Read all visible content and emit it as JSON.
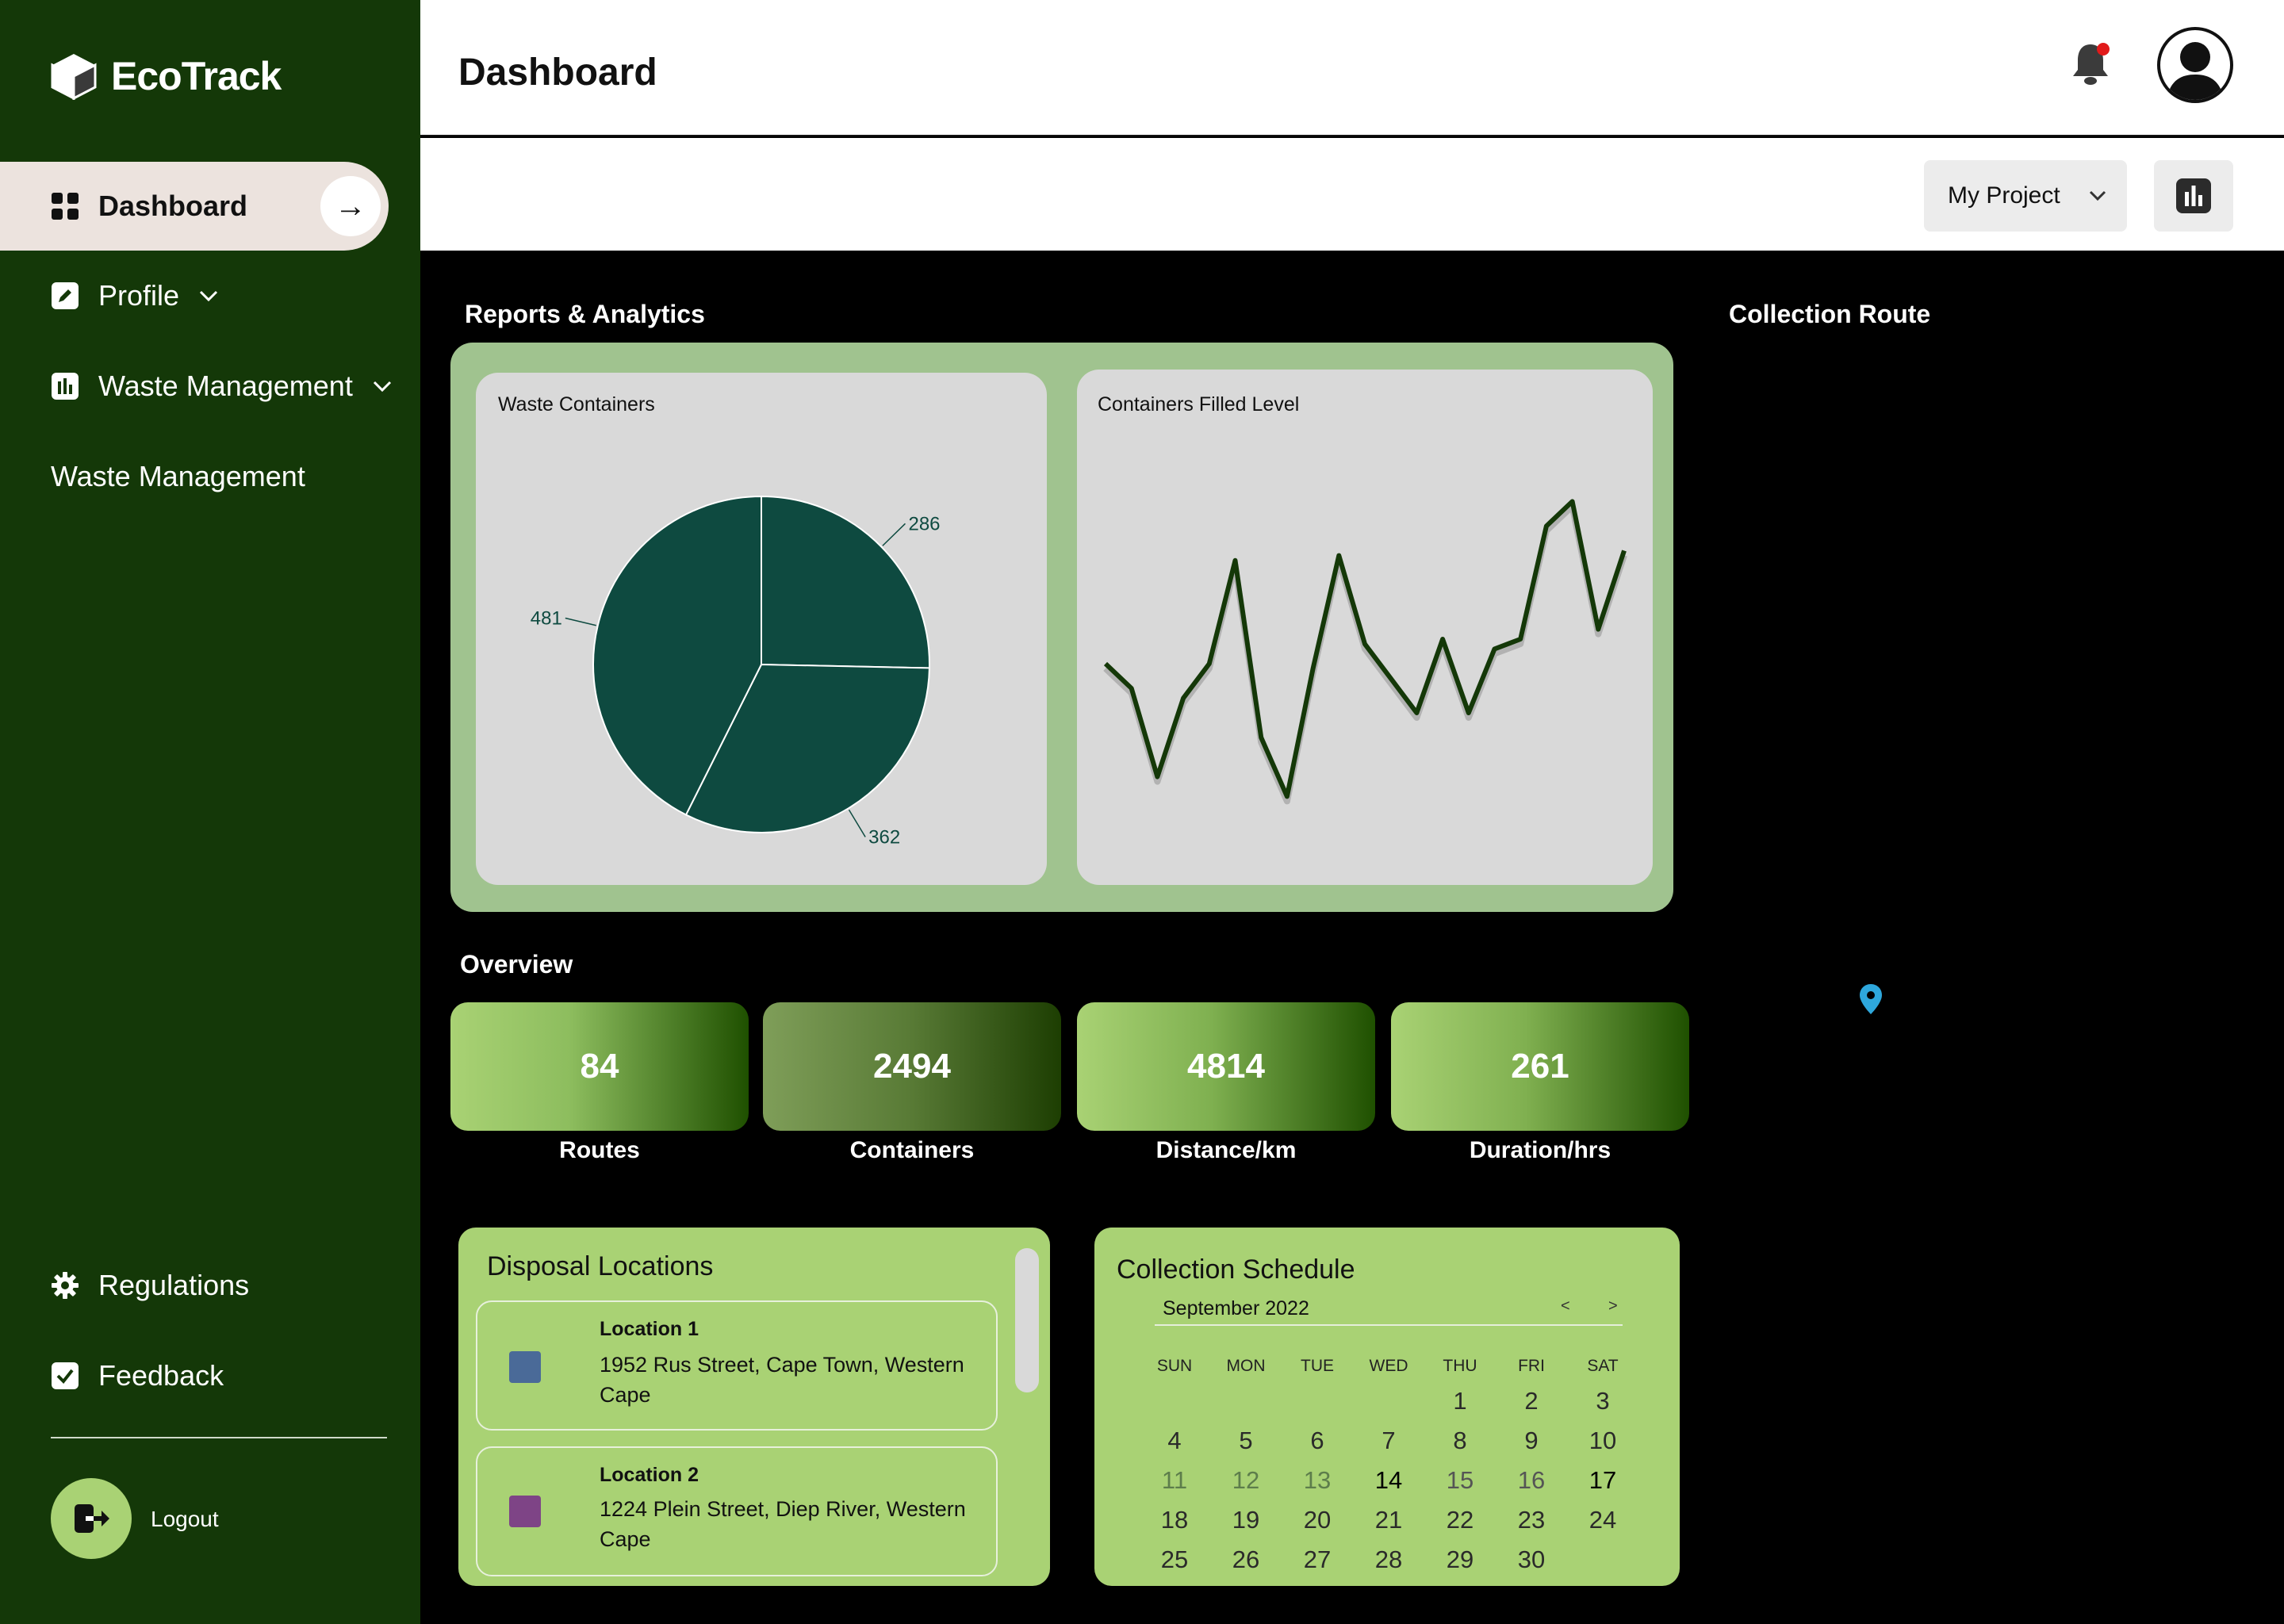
{
  "app": {
    "name": "EcoTrack"
  },
  "sidebar": {
    "items": [
      {
        "label": "Dashboard",
        "icon": "grid-icon",
        "active": true
      },
      {
        "label": "Profile",
        "icon": "edit-icon"
      },
      {
        "label": "Waste Management",
        "icon": "bar-chart-icon"
      },
      {
        "label": "Waste Management"
      }
    ],
    "bottom_items": [
      {
        "label": "Regulations",
        "icon": "gear-icon"
      },
      {
        "label": "Feedback",
        "icon": "check-icon"
      }
    ],
    "logout_label": "Logout"
  },
  "header": {
    "title": "Dashboard",
    "project_select": "My Project"
  },
  "reports": {
    "title": "Reports & Analytics",
    "pie_title": "Waste Containers",
    "line_title": "Containers Filled Level"
  },
  "chart_data": [
    {
      "type": "pie",
      "title": "Waste Containers",
      "values": [
        286,
        362,
        481
      ],
      "colors": [
        "#0e4a40",
        "#0e4a40",
        "#0e4a40"
      ]
    },
    {
      "type": "line",
      "title": "Containers Filled Level",
      "values": [
        45,
        40,
        22,
        38,
        45,
        66,
        30,
        18,
        44,
        67,
        49,
        42,
        35,
        50,
        35,
        48,
        50,
        73,
        78,
        52,
        68
      ],
      "ylim": [
        0,
        100
      ],
      "color": "#143808"
    }
  ],
  "route": {
    "title": "Collection Route"
  },
  "overview": {
    "title": "Overview",
    "tiles": [
      {
        "value": "84",
        "label": "Routes"
      },
      {
        "value": "2494",
        "label": "Containers"
      },
      {
        "value": "4814",
        "label": "Distance/km"
      },
      {
        "value": "261",
        "label": "Duration/hrs"
      }
    ]
  },
  "disposal": {
    "title": "Disposal Locations",
    "locations": [
      {
        "name": "Location 1",
        "address": "1952 Rus Street, Cape Town, Western Cape",
        "color": "#4a6a98"
      },
      {
        "name": "Location 2",
        "address": "1224 Plein Street, Diep River, Western Cape",
        "color": "#7e4486"
      }
    ]
  },
  "schedule": {
    "title": "Collection Schedule",
    "month": "September 2022",
    "prev": "<",
    "next": ">",
    "weekdays": [
      "SUN",
      "MON",
      "TUE",
      "WED",
      "THU",
      "FRI",
      "SAT"
    ],
    "weeks": [
      [
        "",
        "",
        "",
        "",
        "1",
        "2",
        "3"
      ],
      [
        "4",
        "5",
        "6",
        "7",
        "8",
        "9",
        "10"
      ],
      [
        "11",
        "12",
        "13",
        "14",
        "15",
        "16",
        "17"
      ],
      [
        "18",
        "19",
        "20",
        "21",
        "22",
        "23",
        "24"
      ],
      [
        "25",
        "26",
        "27",
        "28",
        "29",
        "30",
        ""
      ]
    ]
  }
}
